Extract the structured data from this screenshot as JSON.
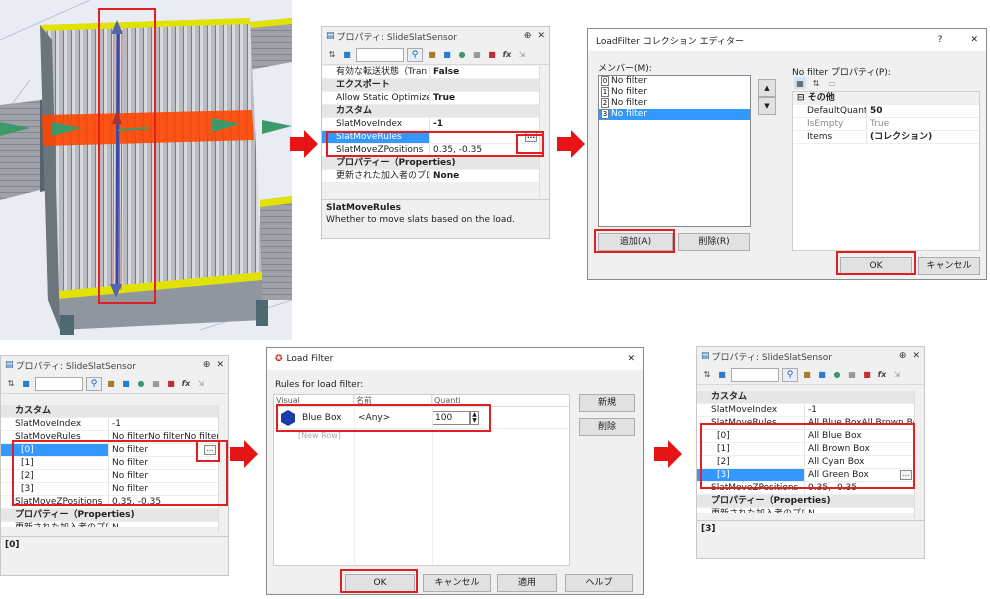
{
  "colors": {
    "highlight": "#e02020",
    "selection": "#3399ff",
    "accent": "#1d5fa8"
  },
  "prop_panel_1": {
    "title": "プロパティ: SlideSlatSensor",
    "rows": [
      {
        "k": "有効な転送状態（Tran",
        "v": "False"
      },
      {
        "k": "エクスポート",
        "section": true
      },
      {
        "k": "Allow Static Optimize",
        "v": "True"
      },
      {
        "k": "カスタム",
        "section": true
      },
      {
        "k": "SlatMoveIndex",
        "v": "-1"
      },
      {
        "k": "SlatMoveRules",
        "v": "",
        "selected": true
      },
      {
        "k": "SlatMoveZPositions",
        "v": "0.35, -0.35"
      },
      {
        "k": "プロパティー（Properties)",
        "section": true
      },
      {
        "k": "更新された加入者のプロ",
        "v": "None"
      }
    ],
    "desc_title": "SlatMoveRules",
    "desc_text": "Whether to move slats based on the load."
  },
  "collection_editor": {
    "title": "LoadFilter コレクション エディター",
    "help": "?",
    "close": "✕",
    "members_label": "メンバー(M):",
    "members": [
      "No filter",
      "No filter",
      "No filter",
      "No filter"
    ],
    "indexes": [
      "0",
      "1",
      "2",
      "3"
    ],
    "props_label": "No filter プロパティ(P):",
    "section": "その他",
    "props": [
      {
        "k": "DefaultQuantity",
        "v": "50"
      },
      {
        "k": "IsEmpty",
        "v": "True"
      },
      {
        "k": "Items",
        "v": "(コレクション)"
      }
    ],
    "add": "追加(A)",
    "remove": "削除(R)",
    "ok": "OK",
    "cancel": "キャンセル",
    "up": "▲",
    "down": "▼"
  },
  "prop_panel_2": {
    "title": "プロパティ: SlideSlatSensor",
    "rows": [
      {
        "k": "カスタム",
        "section": true
      },
      {
        "k": "SlatMoveIndex",
        "v": "-1"
      },
      {
        "k": "SlatMoveRules",
        "v": "No filterNo filterNo filter"
      },
      {
        "k": "[0]",
        "v": "No filter",
        "selected": true,
        "sub": true
      },
      {
        "k": "[1]",
        "v": "No filter",
        "sub": true
      },
      {
        "k": "[2]",
        "v": "No filter",
        "sub": true
      },
      {
        "k": "[3]",
        "v": "No filter",
        "sub": true
      },
      {
        "k": "SlatMoveZPositions",
        "v": "0.35, -0.35"
      },
      {
        "k": "プロパティー（Properties)",
        "section": true
      },
      {
        "k": "更新された加入者のプロ",
        "v": "N"
      }
    ],
    "desc_title": "[0]"
  },
  "load_filter": {
    "title": "Load Filter",
    "close": "✕",
    "rules_label": "Rules for load filter:",
    "columns": [
      "Visual",
      "名前",
      "Quanti"
    ],
    "row": {
      "name": "Blue Box",
      "filter": "<Any>",
      "qty": "100"
    },
    "new_row": "[New Row]",
    "new": "新規",
    "delete": "削除",
    "ok": "OK",
    "cancel": "キャンセル",
    "apply": "適用",
    "help": "ヘルプ"
  },
  "prop_panel_3": {
    "title": "プロパティ: SlideSlatSensor",
    "rows": [
      {
        "k": "カスタム",
        "section": true
      },
      {
        "k": "SlatMoveIndex",
        "v": "-1"
      },
      {
        "k": "SlatMoveRules",
        "v": "All Blue BoxAll Brown Bo"
      },
      {
        "k": "[0]",
        "v": "All Blue Box",
        "sub": true
      },
      {
        "k": "[1]",
        "v": "All Brown Box",
        "sub": true
      },
      {
        "k": "[2]",
        "v": "All Cyan Box",
        "sub": true
      },
      {
        "k": "[3]",
        "v": "All Green Box",
        "selected": true,
        "sub": true
      },
      {
        "k": "SlatMoveZPositions",
        "v": "0.35, -0.35"
      },
      {
        "k": "プロパティー（Properties)",
        "section": true
      },
      {
        "k": "更新された加入者のプロ",
        "v": "N"
      }
    ],
    "desc_title": "[3]"
  }
}
